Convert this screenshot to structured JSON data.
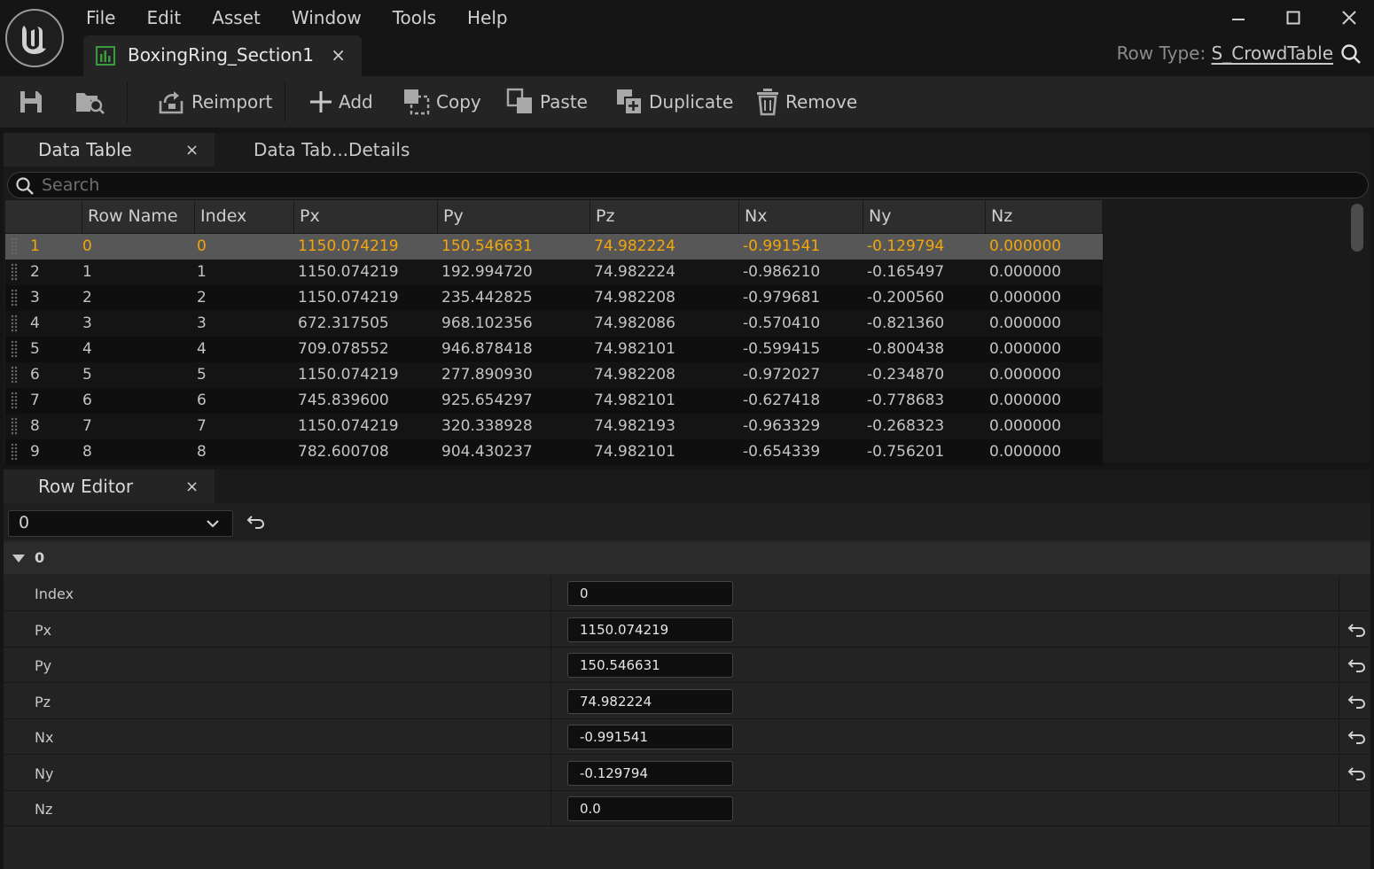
{
  "menu": [
    "File",
    "Edit",
    "Asset",
    "Window",
    "Tools",
    "Help"
  ],
  "document_tab": {
    "title": "BoxingRing_Section1",
    "close": "×"
  },
  "row_type": {
    "label": "Row Type: ",
    "value": "S_CrowdTable"
  },
  "toolbar": {
    "reimport": "Reimport",
    "add": "Add",
    "copy": "Copy",
    "paste": "Paste",
    "duplicate": "Duplicate",
    "remove": "Remove"
  },
  "panels": {
    "data_table_tab": "Data Table",
    "details_tab": "Data Tab...Details",
    "row_editor_tab": "Row Editor",
    "close": "×"
  },
  "search": {
    "placeholder": "Search"
  },
  "table": {
    "columns": [
      "",
      "Row Name",
      "Index",
      "Px",
      "Py",
      "Pz",
      "Nx",
      "Ny",
      "Nz"
    ],
    "rows": [
      [
        "1",
        "0",
        "0",
        "1150.074219",
        "150.546631",
        "74.982224",
        "-0.991541",
        "-0.129794",
        "0.000000"
      ],
      [
        "2",
        "1",
        "1",
        "1150.074219",
        "192.994720",
        "74.982224",
        "-0.986210",
        "-0.165497",
        "0.000000"
      ],
      [
        "3",
        "2",
        "2",
        "1150.074219",
        "235.442825",
        "74.982208",
        "-0.979681",
        "-0.200560",
        "0.000000"
      ],
      [
        "4",
        "3",
        "3",
        "672.317505",
        "968.102356",
        "74.982086",
        "-0.570410",
        "-0.821360",
        "0.000000"
      ],
      [
        "5",
        "4",
        "4",
        "709.078552",
        "946.878418",
        "74.982101",
        "-0.599415",
        "-0.800438",
        "0.000000"
      ],
      [
        "6",
        "5",
        "5",
        "1150.074219",
        "277.890930",
        "74.982208",
        "-0.972027",
        "-0.234870",
        "0.000000"
      ],
      [
        "7",
        "6",
        "6",
        "745.839600",
        "925.654297",
        "74.982101",
        "-0.627418",
        "-0.778683",
        "0.000000"
      ],
      [
        "8",
        "7",
        "7",
        "1150.074219",
        "320.338928",
        "74.982193",
        "-0.963329",
        "-0.268323",
        "0.000000"
      ],
      [
        "9",
        "8",
        "8",
        "782.600708",
        "904.430237",
        "74.982101",
        "-0.654339",
        "-0.756201",
        "0.000000"
      ]
    ],
    "selected_row": 0
  },
  "row_editor": {
    "selected_row": "0",
    "category": "0",
    "properties": [
      {
        "name": "Index",
        "value": "0",
        "reset": false
      },
      {
        "name": "Px",
        "value": "1150.074219",
        "reset": true
      },
      {
        "name": "Py",
        "value": "150.546631",
        "reset": true
      },
      {
        "name": "Pz",
        "value": "74.982224",
        "reset": true
      },
      {
        "name": "Nx",
        "value": "-0.991541",
        "reset": true
      },
      {
        "name": "Ny",
        "value": "-0.129794",
        "reset": true
      },
      {
        "name": "Nz",
        "value": "0.0",
        "reset": false
      }
    ]
  },
  "colors": {
    "selected_text": "#f2a60c",
    "background": "#151515",
    "panel": "#242424"
  }
}
